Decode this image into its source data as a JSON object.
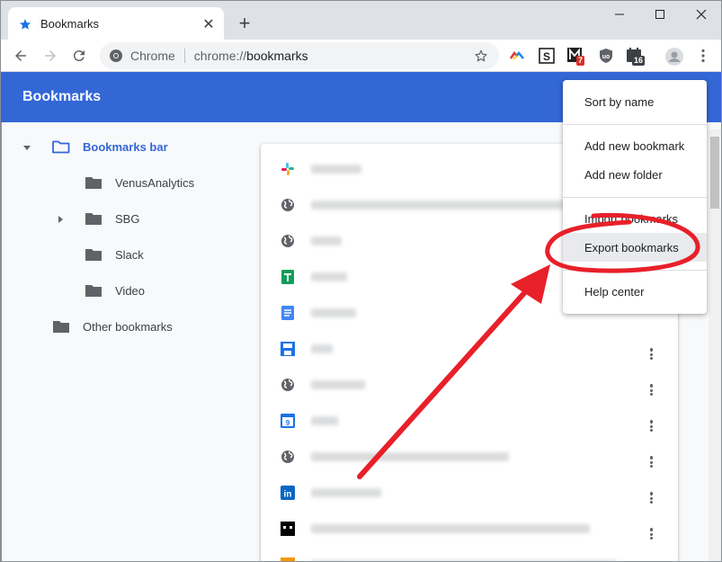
{
  "tab": {
    "title": "Bookmarks",
    "close_glyph": "✕"
  },
  "toolbar": {
    "new_tab_glyph": "+",
    "omnibox_label": "Chrome",
    "url_scheme": "chrome://",
    "url_path": "bookmarks"
  },
  "extensions": {
    "badges": [
      "7",
      "16"
    ]
  },
  "header": {
    "title": "Bookmarks"
  },
  "tree": {
    "items": [
      {
        "label": "Bookmarks bar",
        "icon": "folder-open-icon",
        "selected": true
      },
      {
        "label": "VenusAnalytics",
        "icon": "folder-icon"
      },
      {
        "label": "SBG",
        "icon": "folder-icon"
      },
      {
        "label": "Slack",
        "icon": "folder-icon"
      },
      {
        "label": "Video",
        "icon": "folder-icon"
      },
      {
        "label": "Other bookmarks",
        "icon": "folder-icon"
      }
    ]
  },
  "bookmarks": {
    "rows": [
      {
        "icon": "slack-icon"
      },
      {
        "icon": "globe-icon"
      },
      {
        "icon": "globe-icon"
      },
      {
        "icon": "sheets-icon"
      },
      {
        "icon": "docs-icon"
      },
      {
        "icon": "save-icon"
      },
      {
        "icon": "globe-icon"
      },
      {
        "icon": "calendar-icon"
      },
      {
        "icon": "globe-icon"
      },
      {
        "icon": "linkedin-icon"
      },
      {
        "icon": "dark-app-icon"
      },
      {
        "icon": "orange-app-icon"
      }
    ]
  },
  "menu": {
    "items": [
      {
        "label": "Sort by name"
      },
      {
        "label": "Add new bookmark"
      },
      {
        "label": "Add new folder"
      },
      {
        "label": "Import bookmarks"
      },
      {
        "label": "Export bookmarks"
      },
      {
        "label": "Help center"
      }
    ]
  },
  "colors": {
    "header_blue": "#3367d6",
    "annotation_red": "#e8202a",
    "selected_text": "#3367d6"
  }
}
